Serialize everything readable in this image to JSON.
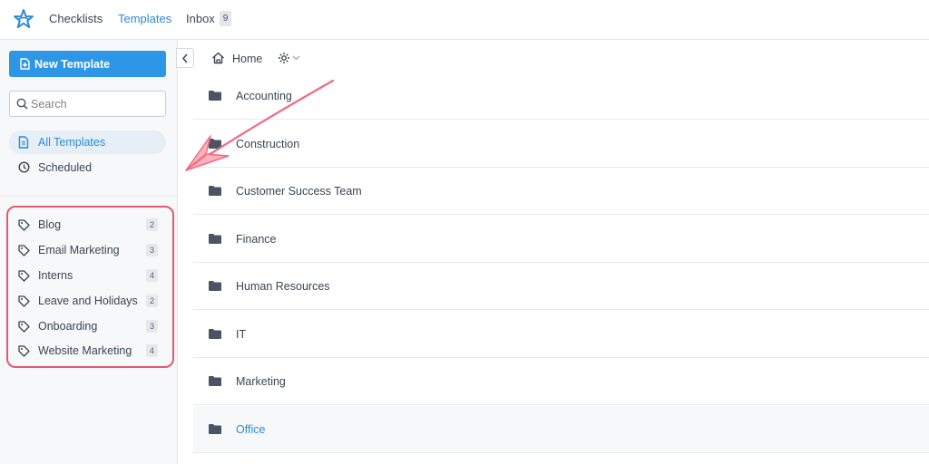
{
  "app": {
    "nav": [
      {
        "label": "Checklists"
      },
      {
        "label": "Templates"
      },
      {
        "label": "Inbox"
      }
    ],
    "inbox_count": "9",
    "accent_color": "#2c8ad6"
  },
  "sidebar": {
    "new_template_label": "New Template",
    "search_placeholder": "Search",
    "items": [
      {
        "label": "All Templates",
        "icon": "document-icon",
        "active": true
      },
      {
        "label": "Scheduled",
        "icon": "clock-icon",
        "active": false
      }
    ],
    "tags": [
      {
        "label": "Blog",
        "count": "2"
      },
      {
        "label": "Email Marketing",
        "count": "3"
      },
      {
        "label": "Interns",
        "count": "4"
      },
      {
        "label": "Leave and Holidays",
        "count": "2"
      },
      {
        "label": "Onboarding",
        "count": "3"
      },
      {
        "label": "Website Marketing",
        "count": "4"
      }
    ],
    "highlight_color": "#e05a72"
  },
  "main": {
    "breadcrumb": {
      "home_label": "Home"
    },
    "folders": [
      {
        "name": "Accounting"
      },
      {
        "name": "Construction"
      },
      {
        "name": "Customer Success Team"
      },
      {
        "name": "Finance"
      },
      {
        "name": "Human Resources"
      },
      {
        "name": "IT"
      },
      {
        "name": "Marketing"
      },
      {
        "name": "Office"
      }
    ],
    "selected_folder": "Office"
  }
}
